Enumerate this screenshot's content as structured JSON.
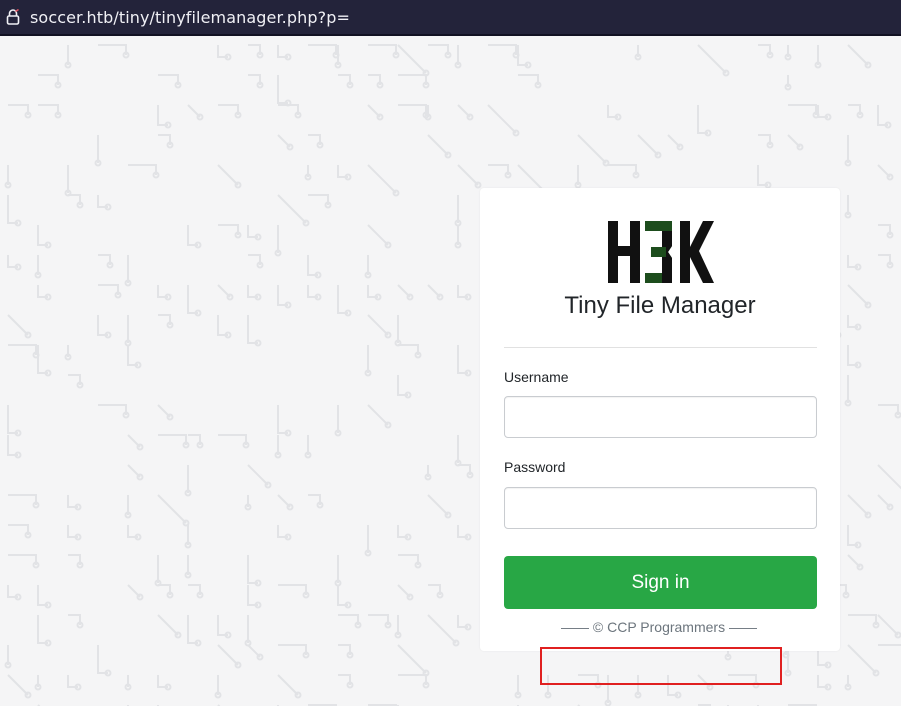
{
  "browser": {
    "url": "soccer.htb/tiny/tinyfilemanager.php?p="
  },
  "login": {
    "logo_text": "H3K",
    "app_title": "Tiny File Manager",
    "username_label": "Username",
    "username_value": "",
    "password_label": "Password",
    "password_value": "",
    "sign_in_label": "Sign in"
  },
  "footer": {
    "text": "—— © CCP Programmers ——"
  },
  "colors": {
    "button": "#28a745",
    "logo_dark": "#111111",
    "logo_accent": "#1d4d1d",
    "highlight": "#e02020"
  }
}
